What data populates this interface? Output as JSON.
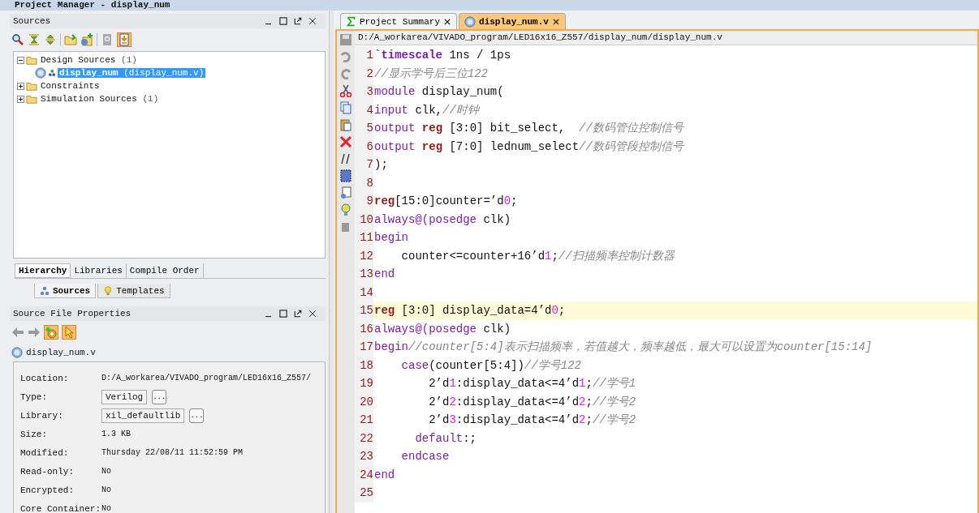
{
  "title_bar": {
    "text": "Project Manager - display_num"
  },
  "sources_panel": {
    "title": "Sources",
    "tree": [
      {
        "kind": "folder",
        "label": "Design Sources",
        "count": "(1)",
        "expanded": true,
        "selected": false,
        "children": [
          {
            "kind": "module",
            "label": "display_num",
            "detail": "(display_num.v)",
            "selected": true
          }
        ]
      },
      {
        "kind": "folder",
        "label": "Constraints",
        "expanded": false,
        "selected": false
      },
      {
        "kind": "folder",
        "label": "Simulation Sources",
        "count": "(1)",
        "expanded": false,
        "selected": false
      }
    ],
    "view_tabs": [
      {
        "label": "Hierarchy",
        "selected": true
      },
      {
        "label": "Libraries",
        "selected": false
      },
      {
        "label": "Compile Order",
        "selected": false
      }
    ],
    "bottom_tabs": [
      {
        "kind": "hierarchy",
        "label": "Sources",
        "selected": true
      },
      {
        "kind": "bulb",
        "label": "Templates",
        "selected": false
      }
    ]
  },
  "properties_panel": {
    "title": "Source File Properties",
    "file": "display_num.v",
    "rows": [
      {
        "kind": "text",
        "label": "Location:",
        "value": "D:/A_workarea/VIVADO_program/LED16x16_Z557/"
      },
      {
        "kind": "field",
        "label": "Type:",
        "value": "Verilog",
        "button": "..."
      },
      {
        "kind": "field",
        "label": "Library:",
        "value": "xil_defaultlib",
        "button": "..."
      },
      {
        "kind": "text",
        "label": "Size:",
        "value": "1.3 KB"
      },
      {
        "kind": "text",
        "label": "Modified:",
        "value": "Thursday 22/08/11 11:52:59 PM"
      },
      {
        "kind": "text",
        "label": "Read-only:",
        "value": "No"
      },
      {
        "kind": "text",
        "label": "Encrypted:",
        "value": "No"
      },
      {
        "kind": "text",
        "label": "Core Container:",
        "value": "No"
      }
    ]
  },
  "editor": {
    "tabs": [
      {
        "kind": "summary",
        "label": "Project Summary",
        "selected": false
      },
      {
        "kind": "verilog",
        "label": "display_num.v",
        "selected": true
      }
    ],
    "path": "D:/A_workarea/VIVADO_program/LED16x16_Z557/display_num/display_num.v",
    "lines": [
      {
        "number": "1",
        "current": false,
        "tokens": [
          {
            "kind": "directive",
            "text": "`timescale"
          },
          {
            "kind": "plain",
            "text": " 1ns / 1ps"
          }
        ]
      },
      {
        "number": "2",
        "current": false,
        "tokens": [
          {
            "kind": "comment",
            "text": "//显示学号后三位122"
          }
        ]
      },
      {
        "number": "3",
        "current": false,
        "tokens": [
          {
            "kind": "kw",
            "text": "module"
          },
          {
            "kind": "plain",
            "text": " display_num("
          }
        ]
      },
      {
        "number": "4",
        "current": false,
        "tokens": [
          {
            "kind": "kw",
            "text": "input"
          },
          {
            "kind": "plain",
            "text": " clk,"
          },
          {
            "kind": "comment",
            "text": "//时钟"
          }
        ]
      },
      {
        "number": "5",
        "current": false,
        "tokens": [
          {
            "kind": "kw",
            "text": "output"
          },
          {
            "kind": "reg",
            "text": " reg"
          },
          {
            "kind": "plain",
            "text": " [3:0] bit_select,  "
          },
          {
            "kind": "comment",
            "text": "//数码管位控制信号"
          }
        ]
      },
      {
        "number": "6",
        "current": false,
        "tokens": [
          {
            "kind": "kw",
            "text": "output"
          },
          {
            "kind": "reg",
            "text": " reg"
          },
          {
            "kind": "plain",
            "text": " [7:0] lednum_select"
          },
          {
            "kind": "comment",
            "text": "//数码管段控制信号"
          }
        ]
      },
      {
        "number": "7",
        "current": false,
        "tokens": [
          {
            "kind": "plain",
            "text": ");"
          }
        ]
      },
      {
        "number": "8",
        "current": false
      },
      {
        "number": "9",
        "current": false,
        "tokens": [
          {
            "kind": "reg",
            "text": "reg"
          },
          {
            "kind": "plain",
            "text": "[15:0]counter=’d"
          },
          {
            "kind": "num",
            "text": "0"
          },
          {
            "kind": "plain",
            "text": ";"
          }
        ]
      },
      {
        "number": "10",
        "current": false,
        "tokens": [
          {
            "kind": "kw",
            "text": "always@(posedge"
          },
          {
            "kind": "plain",
            "text": " clk)"
          }
        ]
      },
      {
        "number": "11",
        "current": false,
        "tokens": [
          {
            "kind": "kw",
            "text": "begin"
          }
        ]
      },
      {
        "number": "12",
        "current": false,
        "tokens": [
          {
            "kind": "plain",
            "text": "    counter<=counter+16’d"
          },
          {
            "kind": "num",
            "text": "1"
          },
          {
            "kind": "plain",
            "text": ";"
          },
          {
            "kind": "comment",
            "text": "//扫描频率控制计数器"
          }
        ]
      },
      {
        "number": "13",
        "current": false,
        "tokens": [
          {
            "kind": "kw",
            "text": "end"
          }
        ]
      },
      {
        "number": "14",
        "current": false
      },
      {
        "number": "15",
        "current": true,
        "tokens": [
          {
            "kind": "reg",
            "text": "reg"
          },
          {
            "kind": "plain",
            "text": " [3:0] display_data=4’d"
          },
          {
            "kind": "num",
            "text": "0"
          },
          {
            "kind": "plain",
            "text": ";"
          }
        ]
      },
      {
        "number": "16",
        "current": false,
        "tokens": [
          {
            "kind": "kw",
            "text": "always@(posedge"
          },
          {
            "kind": "plain",
            "text": " clk)"
          }
        ]
      },
      {
        "number": "17",
        "current": false,
        "tokens": [
          {
            "kind": "kw",
            "text": "begin"
          },
          {
            "kind": "comment",
            "text": "//counter[5:4]表示扫描频率，若值越大，频率越低，最大可以设置为counter[15:14]"
          }
        ]
      },
      {
        "number": "18",
        "current": false,
        "tokens": [
          {
            "kind": "kw",
            "text": "    case"
          },
          {
            "kind": "plain",
            "text": "(counter[5:4])"
          },
          {
            "kind": "comment",
            "text": "//学号122"
          }
        ]
      },
      {
        "number": "19",
        "current": false,
        "tokens": [
          {
            "kind": "plain",
            "text": "        2’d"
          },
          {
            "kind": "num",
            "text": "1"
          },
          {
            "kind": "plain",
            "text": ":display_data<=4’d"
          },
          {
            "kind": "num",
            "text": "1"
          },
          {
            "kind": "plain",
            "text": ";"
          },
          {
            "kind": "comment",
            "text": "//学号1"
          }
        ]
      },
      {
        "number": "20",
        "current": false,
        "tokens": [
          {
            "kind": "plain",
            "text": "        2’d"
          },
          {
            "kind": "num",
            "text": "2"
          },
          {
            "kind": "plain",
            "text": ":display_data<=4’d"
          },
          {
            "kind": "num",
            "text": "2"
          },
          {
            "kind": "plain",
            "text": ";"
          },
          {
            "kind": "comment",
            "text": "//学号2"
          }
        ]
      },
      {
        "number": "21",
        "current": false,
        "tokens": [
          {
            "kind": "plain",
            "text": "        2’d"
          },
          {
            "kind": "num",
            "text": "3"
          },
          {
            "kind": "plain",
            "text": ":display_data<=4’d"
          },
          {
            "kind": "num",
            "text": "2"
          },
          {
            "kind": "plain",
            "text": ";"
          },
          {
            "kind": "comment",
            "text": "//学号2"
          }
        ]
      },
      {
        "number": "22",
        "current": false,
        "tokens": [
          {
            "kind": "kw",
            "text": "      default"
          },
          {
            "kind": "plain",
            "text": ":;"
          }
        ]
      },
      {
        "number": "23",
        "current": false,
        "tokens": [
          {
            "kind": "kw",
            "text": "    endcase"
          }
        ]
      },
      {
        "number": "24",
        "current": false,
        "tokens": [
          {
            "kind": "kw",
            "text": "end"
          }
        ]
      },
      {
        "number": "25",
        "current": false
      }
    ]
  }
}
